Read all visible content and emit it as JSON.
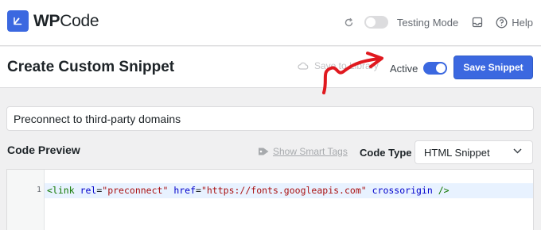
{
  "brand": {
    "name_bold": "WP",
    "name_rest": "Code"
  },
  "topbar": {
    "refresh_icon": "refresh-icon",
    "testing_mode_label": "Testing Mode",
    "testing_mode_on": false,
    "inbox_icon": "inbox-icon",
    "help_label": "Help"
  },
  "header": {
    "title": "Create Custom Snippet",
    "save_to_library_label": "Save to Library",
    "active_label": "Active",
    "active_on": true,
    "save_button_label": "Save Snippet"
  },
  "snippet": {
    "title_value": "Preconnect to third-party domains",
    "code_preview_label": "Code Preview",
    "smart_tags_label": "Show Smart Tags",
    "code_type_label": "Code Type",
    "code_type_value": "HTML Snippet",
    "code_lines": [
      {
        "number": "1",
        "text": "<link rel=\"preconnect\" href=\"https://fonts.googleapis.com\" crossorigin />"
      }
    ]
  },
  "colors": {
    "accent": "#3b68e0",
    "annotation_arrow": "#e0191f"
  }
}
